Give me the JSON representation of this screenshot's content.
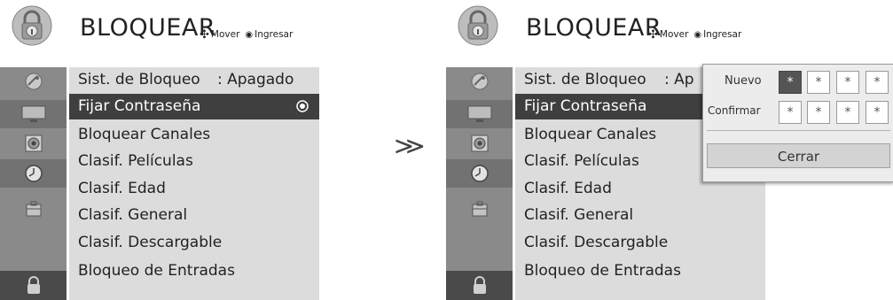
{
  "menu": {
    "title": "BLOQUEAR",
    "hint_move": "Mover",
    "hint_enter": "Ingresar",
    "items": [
      {
        "label": "Sist. de Bloqueo",
        "value": ": Apagado"
      },
      {
        "label": "Fijar Contraseña"
      },
      {
        "label": "Bloquear Canales"
      },
      {
        "label": "Clasif. Películas"
      },
      {
        "label": "Clasif. Edad"
      },
      {
        "label": "Clasif. General"
      },
      {
        "label": "Clasif. Descargable"
      },
      {
        "label": "Bloqueo de Entradas"
      }
    ],
    "truncated_value": ": Ap"
  },
  "popup": {
    "new_label": "Nuevo",
    "confirm_label": "Confirmar",
    "new_digits": [
      "*",
      "*",
      "*",
      "*"
    ],
    "confirm_digits": [
      "*",
      "*",
      "*",
      "*"
    ],
    "close_label": "Cerrar"
  },
  "separator": "≫",
  "icons": [
    "lock-icon",
    "satellite-icon",
    "tv-icon",
    "speaker-icon",
    "clock-icon",
    "briefcase-icon",
    "lock-icon"
  ],
  "colors": {
    "highlight": "#3f3f3f",
    "menu_bg": "#dcdcdc",
    "sidebar": "#8a8a8a",
    "sidebar_selected": "#4a4a4a"
  }
}
